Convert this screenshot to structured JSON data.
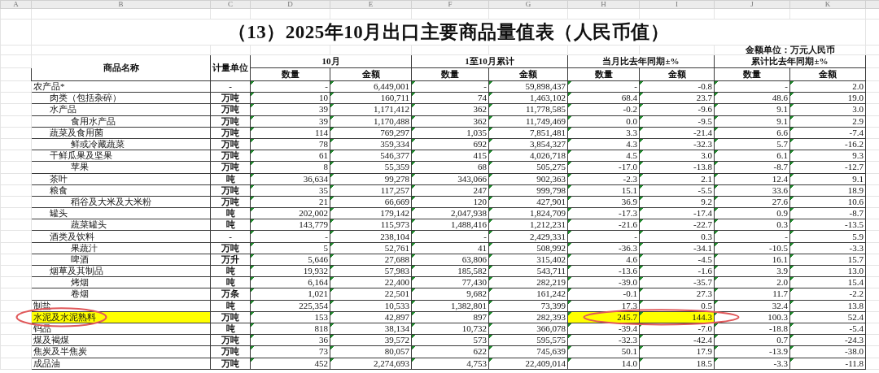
{
  "column_letters": [
    "A",
    "B",
    "C",
    "D",
    "E",
    "F",
    "G",
    "H",
    "I",
    "J",
    "K"
  ],
  "title": "（13）2025年10月出口主要商品量值表（人民币值）",
  "unit_note": "金额单位：万元人民币",
  "table": {
    "name_header": "商品名称",
    "unit_header": "计量单位",
    "groups": [
      {
        "label": "10月",
        "columns": [
          "数量",
          "金额"
        ]
      },
      {
        "label": "1至10月累计",
        "columns": [
          "数量",
          "金额"
        ]
      },
      {
        "label": "当月比去年同期±%",
        "columns": [
          "数量",
          "金额"
        ]
      },
      {
        "label": "累计比去年同期±%",
        "columns": [
          "数量",
          "金额"
        ]
      }
    ],
    "rows": [
      {
        "name": "农产品*",
        "unit": "-",
        "highlighted": false,
        "circled": false,
        "values": [
          {
            "text": "-",
            "highlighted": false
          },
          {
            "text": "6,449,001",
            "highlighted": false
          },
          {
            "text": "-",
            "highlighted": false
          },
          {
            "text": "59,898,437",
            "highlighted": false
          },
          {
            "text": "-",
            "highlighted": false
          },
          {
            "text": "-0.8",
            "highlighted": false
          },
          {
            "text": "-",
            "highlighted": false
          },
          {
            "text": "2.0",
            "highlighted": false
          }
        ],
        "children": [
          {
            "name": "肉类（包括杂碎）",
            "unit": "万吨",
            "highlighted": false,
            "circled": false,
            "values": [
              {
                "text": "10",
                "highlighted": false
              },
              {
                "text": "160,711",
                "highlighted": false
              },
              {
                "text": "74",
                "highlighted": false
              },
              {
                "text": "1,463,102",
                "highlighted": false
              },
              {
                "text": "68.4",
                "highlighted": false
              },
              {
                "text": "23.7",
                "highlighted": false
              },
              {
                "text": "48.6",
                "highlighted": false
              },
              {
                "text": "19.0",
                "highlighted": false
              }
            ]
          },
          {
            "name": "水产品",
            "unit": "万吨",
            "highlighted": false,
            "circled": false,
            "values": [
              {
                "text": "39",
                "highlighted": false
              },
              {
                "text": "1,171,412",
                "highlighted": false
              },
              {
                "text": "362",
                "highlighted": false
              },
              {
                "text": "11,778,585",
                "highlighted": false
              },
              {
                "text": "-0.2",
                "highlighted": false
              },
              {
                "text": "-9.6",
                "highlighted": false
              },
              {
                "text": "9.1",
                "highlighted": false
              },
              {
                "text": "3.0",
                "highlighted": false
              }
            ],
            "children": [
              {
                "name": "食用水产品",
                "unit": "万吨",
                "highlighted": false,
                "circled": false,
                "values": [
                  {
                    "text": "39",
                    "highlighted": false
                  },
                  {
                    "text": "1,170,488",
                    "highlighted": false
                  },
                  {
                    "text": "362",
                    "highlighted": false
                  },
                  {
                    "text": "11,749,469",
                    "highlighted": false
                  },
                  {
                    "text": "0.0",
                    "highlighted": false
                  },
                  {
                    "text": "-9.5",
                    "highlighted": false
                  },
                  {
                    "text": "9.1",
                    "highlighted": false
                  },
                  {
                    "text": "2.9",
                    "highlighted": false
                  }
                ]
              }
            ]
          },
          {
            "name": "蔬菜及食用菌",
            "unit": "万吨",
            "highlighted": false,
            "circled": false,
            "values": [
              {
                "text": "114",
                "highlighted": false
              },
              {
                "text": "769,297",
                "highlighted": false
              },
              {
                "text": "1,035",
                "highlighted": false
              },
              {
                "text": "7,851,481",
                "highlighted": false
              },
              {
                "text": "3.3",
                "highlighted": false
              },
              {
                "text": "-21.4",
                "highlighted": false
              },
              {
                "text": "6.6",
                "highlighted": false
              },
              {
                "text": "-7.4",
                "highlighted": false
              }
            ],
            "children": [
              {
                "name": "鲜或冷藏蔬菜",
                "unit": "万吨",
                "highlighted": false,
                "circled": false,
                "values": [
                  {
                    "text": "78",
                    "highlighted": false
                  },
                  {
                    "text": "359,334",
                    "highlighted": false
                  },
                  {
                    "text": "692",
                    "highlighted": false
                  },
                  {
                    "text": "3,854,327",
                    "highlighted": false
                  },
                  {
                    "text": "4.3",
                    "highlighted": false
                  },
                  {
                    "text": "-32.3",
                    "highlighted": false
                  },
                  {
                    "text": "5.7",
                    "highlighted": false
                  },
                  {
                    "text": "-16.2",
                    "highlighted": false
                  }
                ]
              }
            ]
          },
          {
            "name": "干鲜瓜果及坚果",
            "unit": "万吨",
            "highlighted": false,
            "circled": false,
            "values": [
              {
                "text": "61",
                "highlighted": false
              },
              {
                "text": "546,377",
                "highlighted": false
              },
              {
                "text": "415",
                "highlighted": false
              },
              {
                "text": "4,026,718",
                "highlighted": false
              },
              {
                "text": "4.5",
                "highlighted": false
              },
              {
                "text": "3.0",
                "highlighted": false
              },
              {
                "text": "6.1",
                "highlighted": false
              },
              {
                "text": "9.3",
                "highlighted": false
              }
            ],
            "children": [
              {
                "name": "苹果",
                "unit": "万吨",
                "highlighted": false,
                "circled": false,
                "values": [
                  {
                    "text": "8",
                    "highlighted": false
                  },
                  {
                    "text": "55,359",
                    "highlighted": false
                  },
                  {
                    "text": "68",
                    "highlighted": false
                  },
                  {
                    "text": "505,275",
                    "highlighted": false
                  },
                  {
                    "text": "-17.0",
                    "highlighted": false
                  },
                  {
                    "text": "-13.8",
                    "highlighted": false
                  },
                  {
                    "text": "-8.7",
                    "highlighted": false
                  },
                  {
                    "text": "-12.7",
                    "highlighted": false
                  }
                ]
              }
            ]
          },
          {
            "name": "茶叶",
            "unit": "吨",
            "highlighted": false,
            "circled": false,
            "values": [
              {
                "text": "36,634",
                "highlighted": false
              },
              {
                "text": "99,278",
                "highlighted": false
              },
              {
                "text": "343,066",
                "highlighted": false
              },
              {
                "text": "902,363",
                "highlighted": false
              },
              {
                "text": "-2.3",
                "highlighted": false
              },
              {
                "text": "2.1",
                "highlighted": false
              },
              {
                "text": "12.4",
                "highlighted": false
              },
              {
                "text": "9.1",
                "highlighted": false
              }
            ]
          },
          {
            "name": "粮食",
            "unit": "万吨",
            "highlighted": false,
            "circled": false,
            "values": [
              {
                "text": "35",
                "highlighted": false
              },
              {
                "text": "117,257",
                "highlighted": false
              },
              {
                "text": "247",
                "highlighted": false
              },
              {
                "text": "999,798",
                "highlighted": false
              },
              {
                "text": "15.1",
                "highlighted": false
              },
              {
                "text": "-5.5",
                "highlighted": false
              },
              {
                "text": "33.6",
                "highlighted": false
              },
              {
                "text": "18.9",
                "highlighted": false
              }
            ],
            "children": [
              {
                "name": "稻谷及大米及大米粉",
                "unit": "万吨",
                "highlighted": false,
                "circled": false,
                "values": [
                  {
                    "text": "21",
                    "highlighted": false
                  },
                  {
                    "text": "66,669",
                    "highlighted": false
                  },
                  {
                    "text": "120",
                    "highlighted": false
                  },
                  {
                    "text": "427,901",
                    "highlighted": false
                  },
                  {
                    "text": "36.9",
                    "highlighted": false
                  },
                  {
                    "text": "9.2",
                    "highlighted": false
                  },
                  {
                    "text": "27.6",
                    "highlighted": false
                  },
                  {
                    "text": "10.6",
                    "highlighted": false
                  }
                ]
              }
            ]
          },
          {
            "name": "罐头",
            "unit": "吨",
            "highlighted": false,
            "circled": false,
            "values": [
              {
                "text": "202,002",
                "highlighted": false
              },
              {
                "text": "179,142",
                "highlighted": false
              },
              {
                "text": "2,047,938",
                "highlighted": false
              },
              {
                "text": "1,824,709",
                "highlighted": false
              },
              {
                "text": "-17.3",
                "highlighted": false
              },
              {
                "text": "-17.4",
                "highlighted": false
              },
              {
                "text": "0.9",
                "highlighted": false
              },
              {
                "text": "-8.7",
                "highlighted": false
              }
            ],
            "children": [
              {
                "name": "蔬菜罐头",
                "unit": "吨",
                "highlighted": false,
                "circled": false,
                "values": [
                  {
                    "text": "143,779",
                    "highlighted": false
                  },
                  {
                    "text": "115,973",
                    "highlighted": false
                  },
                  {
                    "text": "1,488,416",
                    "highlighted": false
                  },
                  {
                    "text": "1,212,231",
                    "highlighted": false
                  },
                  {
                    "text": "-21.6",
                    "highlighted": false
                  },
                  {
                    "text": "-22.7",
                    "highlighted": false
                  },
                  {
                    "text": "0.3",
                    "highlighted": false
                  },
                  {
                    "text": "-13.5",
                    "highlighted": false
                  }
                ]
              }
            ]
          },
          {
            "name": "酒类及饮料",
            "unit": "-",
            "highlighted": false,
            "circled": false,
            "values": [
              {
                "text": "-",
                "highlighted": false
              },
              {
                "text": "238,104",
                "highlighted": false
              },
              {
                "text": "-",
                "highlighted": false
              },
              {
                "text": "2,429,331",
                "highlighted": false
              },
              {
                "text": "-",
                "highlighted": false
              },
              {
                "text": "0.3",
                "highlighted": false
              },
              {
                "text": "-",
                "highlighted": false
              },
              {
                "text": "5.9",
                "highlighted": false
              }
            ],
            "children": [
              {
                "name": "果蔬汁",
                "unit": "万吨",
                "highlighted": false,
                "circled": false,
                "values": [
                  {
                    "text": "5",
                    "highlighted": false
                  },
                  {
                    "text": "52,761",
                    "highlighted": false
                  },
                  {
                    "text": "41",
                    "highlighted": false
                  },
                  {
                    "text": "508,992",
                    "highlighted": false
                  },
                  {
                    "text": "-36.3",
                    "highlighted": false
                  },
                  {
                    "text": "-34.1",
                    "highlighted": false
                  },
                  {
                    "text": "-10.5",
                    "highlighted": false
                  },
                  {
                    "text": "-3.3",
                    "highlighted": false
                  }
                ]
              },
              {
                "name": "啤酒",
                "unit": "万升",
                "highlighted": false,
                "circled": false,
                "values": [
                  {
                    "text": "5,646",
                    "highlighted": false
                  },
                  {
                    "text": "27,688",
                    "highlighted": false
                  },
                  {
                    "text": "63,806",
                    "highlighted": false
                  },
                  {
                    "text": "315,402",
                    "highlighted": false
                  },
                  {
                    "text": "4.6",
                    "highlighted": false
                  },
                  {
                    "text": "-4.5",
                    "highlighted": false
                  },
                  {
                    "text": "16.1",
                    "highlighted": false
                  },
                  {
                    "text": "15.7",
                    "highlighted": false
                  }
                ]
              }
            ]
          },
          {
            "name": "烟草及其制品",
            "unit": "吨",
            "highlighted": false,
            "circled": false,
            "values": [
              {
                "text": "19,932",
                "highlighted": false
              },
              {
                "text": "57,983",
                "highlighted": false
              },
              {
                "text": "185,582",
                "highlighted": false
              },
              {
                "text": "543,711",
                "highlighted": false
              },
              {
                "text": "-13.6",
                "highlighted": false
              },
              {
                "text": "-1.6",
                "highlighted": false
              },
              {
                "text": "3.9",
                "highlighted": false
              },
              {
                "text": "13.0",
                "highlighted": false
              }
            ],
            "children": [
              {
                "name": "烤烟",
                "unit": "吨",
                "highlighted": false,
                "circled": false,
                "values": [
                  {
                    "text": "6,164",
                    "highlighted": false
                  },
                  {
                    "text": "22,400",
                    "highlighted": false
                  },
                  {
                    "text": "77,430",
                    "highlighted": false
                  },
                  {
                    "text": "282,219",
                    "highlighted": false
                  },
                  {
                    "text": "-39.0",
                    "highlighted": false
                  },
                  {
                    "text": "-35.7",
                    "highlighted": false
                  },
                  {
                    "text": "2.0",
                    "highlighted": false
                  },
                  {
                    "text": "15.4",
                    "highlighted": false
                  }
                ]
              },
              {
                "name": "卷烟",
                "unit": "万条",
                "highlighted": false,
                "circled": false,
                "values": [
                  {
                    "text": "1,021",
                    "highlighted": false
                  },
                  {
                    "text": "22,501",
                    "highlighted": false
                  },
                  {
                    "text": "9,682",
                    "highlighted": false
                  },
                  {
                    "text": "161,242",
                    "highlighted": false
                  },
                  {
                    "text": "-0.1",
                    "highlighted": false
                  },
                  {
                    "text": "27.3",
                    "highlighted": false
                  },
                  {
                    "text": "11.7",
                    "highlighted": false
                  },
                  {
                    "text": "-2.2",
                    "highlighted": false
                  }
                ]
              }
            ]
          }
        ]
      },
      {
        "name": "制盐",
        "unit": "吨",
        "highlighted": false,
        "circled": false,
        "values": [
          {
            "text": "225,354",
            "highlighted": false
          },
          {
            "text": "10,533",
            "highlighted": false
          },
          {
            "text": "1,382,801",
            "highlighted": false
          },
          {
            "text": "73,399",
            "highlighted": false
          },
          {
            "text": "17.3",
            "highlighted": false
          },
          {
            "text": "0.5",
            "highlighted": false
          },
          {
            "text": "32.4",
            "highlighted": false
          },
          {
            "text": "13.8",
            "highlighted": false
          }
        ]
      },
      {
        "name": "水泥及水泥熟料",
        "unit": "万吨",
        "highlighted": true,
        "circled": true,
        "values": [
          {
            "text": "153",
            "highlighted": false
          },
          {
            "text": "42,897",
            "highlighted": false
          },
          {
            "text": "897",
            "highlighted": false
          },
          {
            "text": "282,393",
            "highlighted": false
          },
          {
            "text": "245.7",
            "highlighted": true
          },
          {
            "text": "144.3",
            "highlighted": true
          },
          {
            "text": "100.3",
            "highlighted": false
          },
          {
            "text": "52.4",
            "highlighted": false
          }
        ]
      },
      {
        "name": "钨品",
        "unit": "吨",
        "highlighted": false,
        "circled": false,
        "values": [
          {
            "text": "818",
            "highlighted": false
          },
          {
            "text": "38,134",
            "highlighted": false
          },
          {
            "text": "10,732",
            "highlighted": false
          },
          {
            "text": "366,078",
            "highlighted": false
          },
          {
            "text": "-39.4",
            "highlighted": false
          },
          {
            "text": "-7.0",
            "highlighted": false
          },
          {
            "text": "-18.8",
            "highlighted": false
          },
          {
            "text": "-5.4",
            "highlighted": false
          }
        ]
      },
      {
        "name": "煤及褐煤",
        "unit": "万吨",
        "highlighted": false,
        "circled": false,
        "values": [
          {
            "text": "36",
            "highlighted": false
          },
          {
            "text": "39,572",
            "highlighted": false
          },
          {
            "text": "573",
            "highlighted": false
          },
          {
            "text": "595,575",
            "highlighted": false
          },
          {
            "text": "-32.3",
            "highlighted": false
          },
          {
            "text": "-42.4",
            "highlighted": false
          },
          {
            "text": "0.7",
            "highlighted": false
          },
          {
            "text": "-24.3",
            "highlighted": false
          }
        ]
      },
      {
        "name": "焦炭及半焦炭",
        "unit": "万吨",
        "highlighted": false,
        "circled": false,
        "values": [
          {
            "text": "73",
            "highlighted": false
          },
          {
            "text": "80,057",
            "highlighted": false
          },
          {
            "text": "622",
            "highlighted": false
          },
          {
            "text": "745,639",
            "highlighted": false
          },
          {
            "text": "50.1",
            "highlighted": false
          },
          {
            "text": "17.9",
            "highlighted": false
          },
          {
            "text": "-13.9",
            "highlighted": false
          },
          {
            "text": "-38.0",
            "highlighted": false
          }
        ]
      },
      {
        "name": "成品油",
        "unit": "万吨",
        "highlighted": false,
        "circled": false,
        "values": [
          {
            "text": "452",
            "highlighted": false
          },
          {
            "text": "2,274,693",
            "highlighted": false
          },
          {
            "text": "4,753",
            "highlighted": false
          },
          {
            "text": "22,409,014",
            "highlighted": false
          },
          {
            "text": "14.0",
            "highlighted": false
          },
          {
            "text": "18.5",
            "highlighted": false
          },
          {
            "text": "-3.3",
            "highlighted": false
          },
          {
            "text": "-11.8",
            "highlighted": false
          }
        ]
      }
    ]
  }
}
